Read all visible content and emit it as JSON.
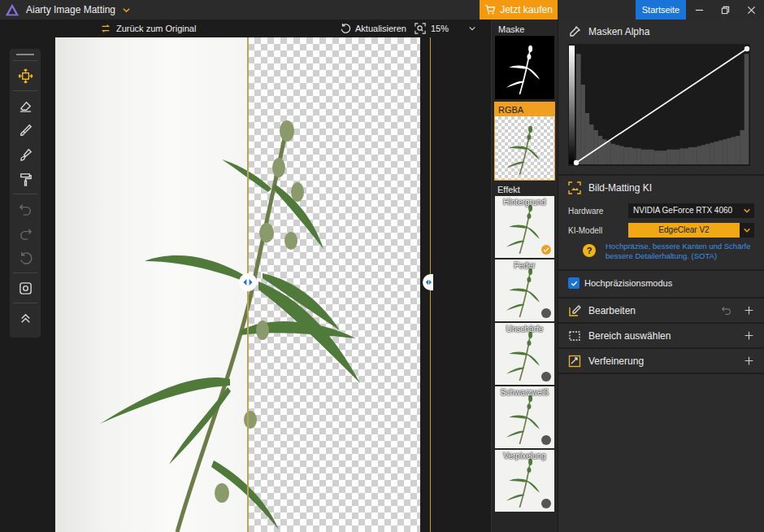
{
  "window": {
    "title": "Aiarty Image Matting",
    "buy": "Jetzt kaufen",
    "home": "Startseite"
  },
  "subbar": {
    "back": "Zurück zum Original",
    "refresh": "Aktualisieren",
    "zoom": "15%"
  },
  "tools": [
    [
      {
        "kind": "move",
        "selected": true,
        "disabled": false
      }
    ],
    [
      {
        "kind": "eraser",
        "selected": false,
        "disabled": false
      },
      {
        "kind": "brush",
        "selected": false,
        "disabled": false
      },
      {
        "kind": "smooth-brush",
        "selected": false,
        "disabled": false
      },
      {
        "kind": "roller",
        "selected": false,
        "disabled": false
      }
    ],
    [
      {
        "kind": "undo",
        "selected": false,
        "disabled": true
      },
      {
        "kind": "redo",
        "selected": false,
        "disabled": true
      },
      {
        "kind": "reset",
        "selected": false,
        "disabled": true
      }
    ],
    [
      {
        "kind": "fit",
        "selected": false,
        "disabled": false
      }
    ],
    [
      {
        "kind": "collapse",
        "selected": false,
        "disabled": false
      }
    ]
  ],
  "views": [
    {
      "label": "Maske",
      "kind": "mask",
      "selected": false
    },
    {
      "label": "RGBA",
      "kind": "rgba",
      "selected": true
    }
  ],
  "effects_label": "Effekt",
  "effects": [
    {
      "label": "Hintergrund",
      "checked": true
    },
    {
      "label": "Feder",
      "checked": false
    },
    {
      "label": "Unschärfe",
      "checked": false
    },
    {
      "label": "Schwarzweiß",
      "checked": false
    },
    {
      "label": "Verpixelung",
      "checked": false
    }
  ],
  "panel": {
    "alpha": {
      "title": "Masken Alpha",
      "histogram": [
        0.97,
        0.7,
        0.45,
        0.35,
        0.3,
        0.25,
        0.22,
        0.2,
        0.18,
        0.17,
        0.16,
        0.15,
        0.15,
        0.14,
        0.14,
        0.13,
        0.13,
        0.13,
        0.12,
        0.12,
        0.12,
        0.13,
        0.13,
        0.13,
        0.14,
        0.14,
        0.15,
        0.15,
        0.16,
        0.17,
        0.18,
        0.19,
        0.2,
        0.21,
        0.22,
        0.23,
        0.24,
        0.25,
        0.3,
        0.97
      ],
      "curve": [
        [
          0,
          0
        ],
        [
          1,
          1
        ]
      ]
    },
    "matting": {
      "title": "Bild-Matting KI",
      "fields": [
        {
          "label": "Hardware",
          "value": "NVIDIA GeForce RTX 4060",
          "highlight": false
        },
        {
          "label": "KI-Modell",
          "value": "EdgeClear  V2",
          "highlight": true
        }
      ],
      "help": "?",
      "hint": "Hochpräzise, bessere Kanten und Schärfe bessere Detailerhaltung. (SOTA)",
      "checkbox": {
        "label": "Hochpräzisionsmodus",
        "checked": true
      }
    },
    "sections": [
      {
        "title": "Bearbeiten",
        "undo_shown": true
      },
      {
        "title": "Bereich auswählen",
        "undo_shown": false
      },
      {
        "title": "Verfeinerung",
        "undo_shown": false
      }
    ]
  }
}
